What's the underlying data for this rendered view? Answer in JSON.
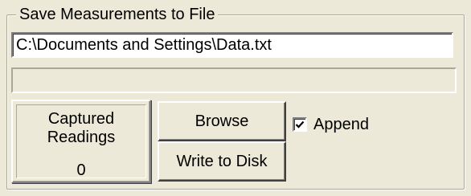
{
  "group": {
    "title": "Save Measurements to File"
  },
  "path_field": {
    "value": "C:\\Documents and Settings\\Data.txt"
  },
  "status_bar": {
    "text": ""
  },
  "readings": {
    "label": "Captured Readings",
    "value": "0"
  },
  "buttons": {
    "browse_label": "Browse",
    "write_label": "Write to Disk"
  },
  "append": {
    "label": "Append",
    "checked": true,
    "icon": "checkmark-icon"
  },
  "colors": {
    "face": "#ece9d8",
    "frame": "#aca899",
    "field": "#ffffff",
    "text": "#000000"
  }
}
